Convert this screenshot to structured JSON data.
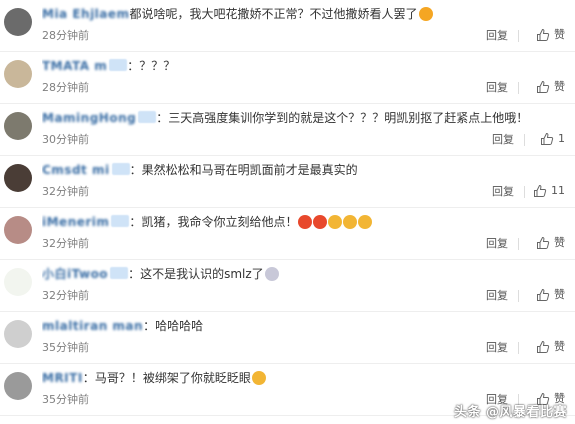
{
  "comments": [
    {
      "user": "Mia Ehjlaem",
      "badge": false,
      "colon": "",
      "text": "都说啥呢，我大吧花撒娇不正常？不过他撒娇看人罢了",
      "emojis": [
        "#f5a623"
      ],
      "time": "28分钟前",
      "reply": "回复",
      "like": "赞",
      "avatar": "#6b6b6b"
    },
    {
      "user": "TMATA m",
      "badge": true,
      "colon": "：",
      "text": "？？？",
      "emojis": [],
      "time": "28分钟前",
      "reply": "回复",
      "like": "赞",
      "avatar": "#c9b79a"
    },
    {
      "user": "MamingHong",
      "badge": true,
      "colon": "：",
      "text": "三天高强度集训你学到的就是这个？？？明凯别抠了赶紧点上他哦！",
      "emojis": [],
      "time": "30分钟前",
      "reply": "回复",
      "like": "1",
      "avatar": "#7d7a6e"
    },
    {
      "user": "Cmsdt mi",
      "badge": true,
      "colon": "：",
      "text": "果然松松和马哥在明凯面前才是最真实的",
      "emojis": [],
      "time": "32分钟前",
      "reply": "回复",
      "like": "11",
      "avatar": "#4a3d36"
    },
    {
      "user": "iMenerim",
      "badge": true,
      "colon": "：",
      "text": "凯猪，我命令你立刻给他点！",
      "emojis": [
        "#e8482c",
        "#e8482c",
        "#f2b534",
        "#f2b534",
        "#f2b534"
      ],
      "time": "32分钟前",
      "reply": "回复",
      "like": "赞",
      "avatar": "#b78c86"
    },
    {
      "user": "小白iTwoo",
      "badge": true,
      "colon": "：",
      "text": "这不是我认识的smlz了",
      "emojis": [
        "#c8c8d8"
      ],
      "time": "32分钟前",
      "reply": "回复",
      "like": "赞",
      "avatar": "#f2f5ef"
    },
    {
      "user": "mlaltiran man",
      "badge": false,
      "colon": "：",
      "text": "哈哈哈哈",
      "emojis": [],
      "time": "35分钟前",
      "reply": "回复",
      "like": "赞",
      "avatar": "#cfcfcf"
    },
    {
      "user": "MRITI",
      "badge": false,
      "colon": "：",
      "text": "马哥？！被绑架了你就眨眨眼",
      "emojis": [
        "#f2b534"
      ],
      "time": "35分钟前",
      "reply": "回复",
      "like": "赞",
      "avatar": "#9a9a9a"
    }
  ],
  "watermark": "头条 @风暴看比赛"
}
